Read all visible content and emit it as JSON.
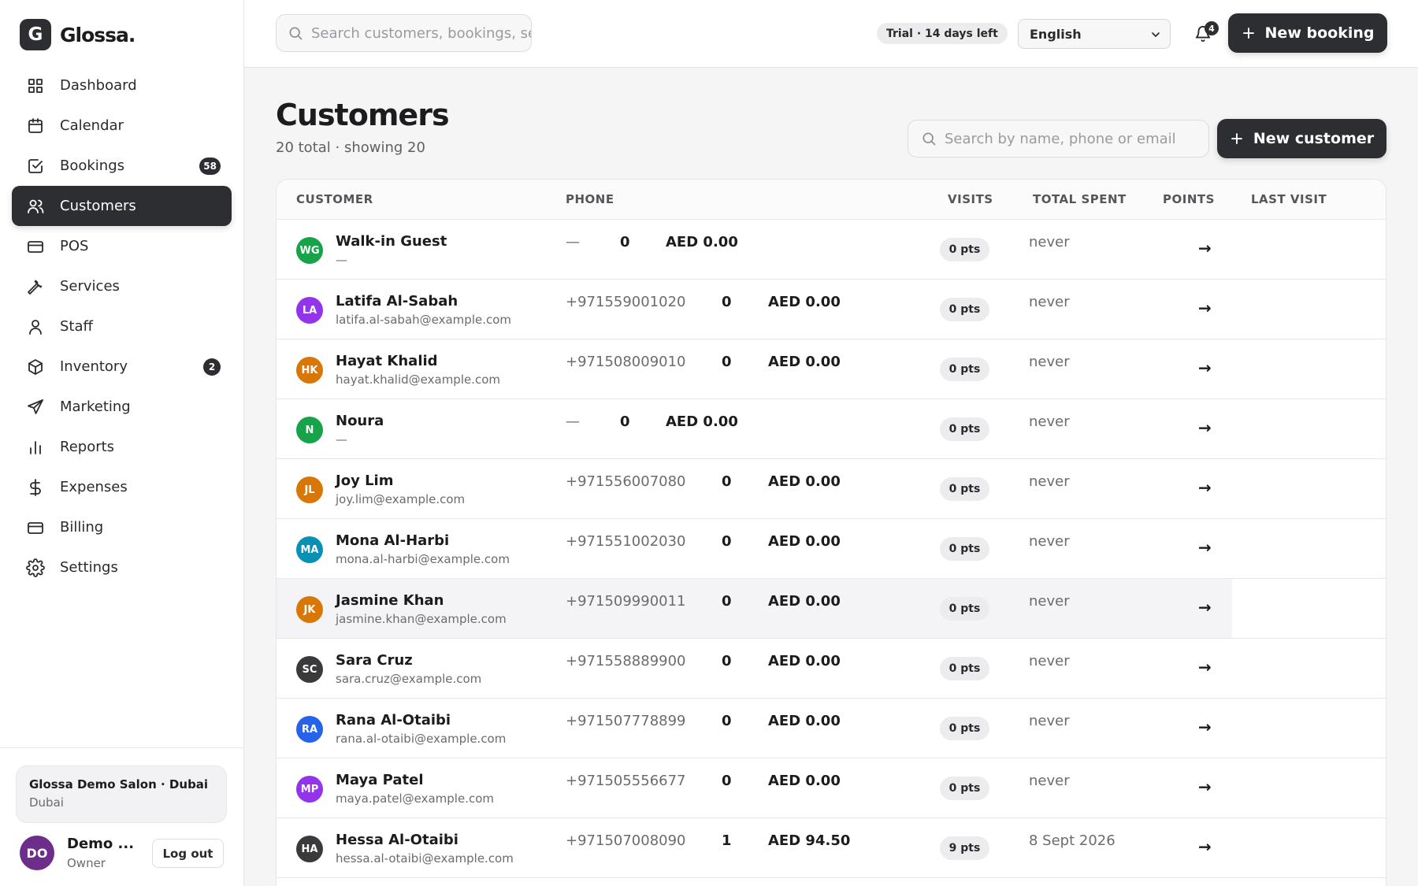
{
  "brand": {
    "mark": "G",
    "name": "Glossa."
  },
  "sidebar": {
    "items": [
      {
        "key": "dashboard",
        "label": "Dashboard",
        "icon": "grid-icon",
        "badge": "",
        "active": false
      },
      {
        "key": "calendar",
        "label": "Calendar",
        "icon": "calendar-icon",
        "badge": "",
        "active": false
      },
      {
        "key": "bookings",
        "label": "Bookings",
        "icon": "check-square-icon",
        "badge": "58",
        "active": false
      },
      {
        "key": "customers",
        "label": "Customers",
        "icon": "users-icon",
        "badge": "",
        "active": true
      },
      {
        "key": "pos",
        "label": "POS",
        "icon": "credit-card-icon",
        "badge": "",
        "active": false
      },
      {
        "key": "services",
        "label": "Services",
        "icon": "wrench-icon",
        "badge": "",
        "active": false
      },
      {
        "key": "staff",
        "label": "Staff",
        "icon": "user-icon",
        "badge": "",
        "active": false
      },
      {
        "key": "inventory",
        "label": "Inventory",
        "icon": "box-icon",
        "badge": "2",
        "active": false
      },
      {
        "key": "marketing",
        "label": "Marketing",
        "icon": "send-icon",
        "badge": "",
        "active": false
      },
      {
        "key": "reports",
        "label": "Reports",
        "icon": "bar-chart-icon",
        "badge": "",
        "active": false
      },
      {
        "key": "expenses",
        "label": "Expenses",
        "icon": "dollar-icon",
        "badge": "",
        "active": false
      },
      {
        "key": "billing",
        "label": "Billing",
        "icon": "credit-card-icon",
        "badge": "",
        "active": false
      },
      {
        "key": "settings",
        "label": "Settings",
        "icon": "gear-icon",
        "badge": "",
        "active": false
      }
    ],
    "org": {
      "name": "Glossa Demo Salon · Dubai",
      "city": "Dubai"
    },
    "user": {
      "initials": "DO",
      "name": "Demo ...",
      "role": "Owner",
      "logout_label": "Log out"
    }
  },
  "topbar": {
    "search_placeholder": "Search customers, bookings, services…",
    "trial_label": "Trial · 14 days left",
    "language": "English",
    "notifications_count": "4",
    "new_booking_label": "New booking"
  },
  "page": {
    "title": "Customers",
    "subtitle": "20 total · showing 20",
    "search_placeholder": "Search by name, phone or email",
    "new_customer_label": "New customer"
  },
  "table": {
    "headers": {
      "customer": "CUSTOMER",
      "phone": "PHONE",
      "visits": "VISITS",
      "total_spent": "TOTAL SPENT",
      "points": "POINTS",
      "last_visit": "LAST VISIT"
    },
    "rows": [
      {
        "initials": "WG",
        "color": "#16a34a",
        "name": "Walk-in Guest",
        "email": "—",
        "phone": "—",
        "visits": "0",
        "spent": "AED 0.00",
        "points": "0 pts",
        "last_visit": "never",
        "arrow": "→"
      },
      {
        "initials": "LA",
        "color": "#9333ea",
        "name": "Latifa Al-Sabah",
        "email": "latifa.al-sabah@example.com",
        "phone": "+971559001020",
        "visits": "0",
        "spent": "AED 0.00",
        "points": "0 pts",
        "last_visit": "never",
        "arrow": "→"
      },
      {
        "initials": "HK",
        "color": "#d97706",
        "name": "Hayat Khalid",
        "email": "hayat.khalid@example.com",
        "phone": "+971508009010",
        "visits": "0",
        "spent": "AED 0.00",
        "points": "0 pts",
        "last_visit": "never",
        "arrow": "→"
      },
      {
        "initials": "N",
        "color": "#16a34a",
        "name": "Noura",
        "email": "—",
        "phone": "—",
        "visits": "0",
        "spent": "AED 0.00",
        "points": "0 pts",
        "last_visit": "never",
        "arrow": "→"
      },
      {
        "initials": "JL",
        "color": "#d97706",
        "name": "Joy Lim",
        "email": "joy.lim@example.com",
        "phone": "+971556007080",
        "visits": "0",
        "spent": "AED 0.00",
        "points": "0 pts",
        "last_visit": "never",
        "arrow": "→"
      },
      {
        "initials": "MA",
        "color": "#0891b2",
        "name": "Mona Al-Harbi",
        "email": "mona.al-harbi@example.com",
        "phone": "+971551002030",
        "visits": "0",
        "spent": "AED 0.00",
        "points": "0 pts",
        "last_visit": "never",
        "arrow": "→"
      },
      {
        "initials": "JK",
        "color": "#d97706",
        "name": "Jasmine Khan",
        "email": "jasmine.khan@example.com",
        "phone": "+971509990011",
        "visits": "0",
        "spent": "AED 0.00",
        "points": "0 pts",
        "last_visit": "never",
        "arrow": "→",
        "hover": true
      },
      {
        "initials": "SC",
        "color": "#3a3a3d",
        "name": "Sara Cruz",
        "email": "sara.cruz@example.com",
        "phone": "+971558889900",
        "visits": "0",
        "spent": "AED 0.00",
        "points": "0 pts",
        "last_visit": "never",
        "arrow": "→"
      },
      {
        "initials": "RA",
        "color": "#2563eb",
        "name": "Rana Al-Otaibi",
        "email": "rana.al-otaibi@example.com",
        "phone": "+971507778899",
        "visits": "0",
        "spent": "AED 0.00",
        "points": "0 pts",
        "last_visit": "never",
        "arrow": "→"
      },
      {
        "initials": "MP",
        "color": "#9333ea",
        "name": "Maya Patel",
        "email": "maya.patel@example.com",
        "phone": "+971505556677",
        "visits": "0",
        "spent": "AED 0.00",
        "points": "0 pts",
        "last_visit": "never",
        "arrow": "→"
      },
      {
        "initials": "HA",
        "color": "#3a3a3d",
        "name": "Hessa Al-Otaibi",
        "email": "hessa.al-otaibi@example.com",
        "phone": "+971507008090",
        "visits": "1",
        "spent": "AED 94.50",
        "points": "9 pts",
        "last_visit": "8 Sept 2026",
        "arrow": "→"
      }
    ]
  }
}
